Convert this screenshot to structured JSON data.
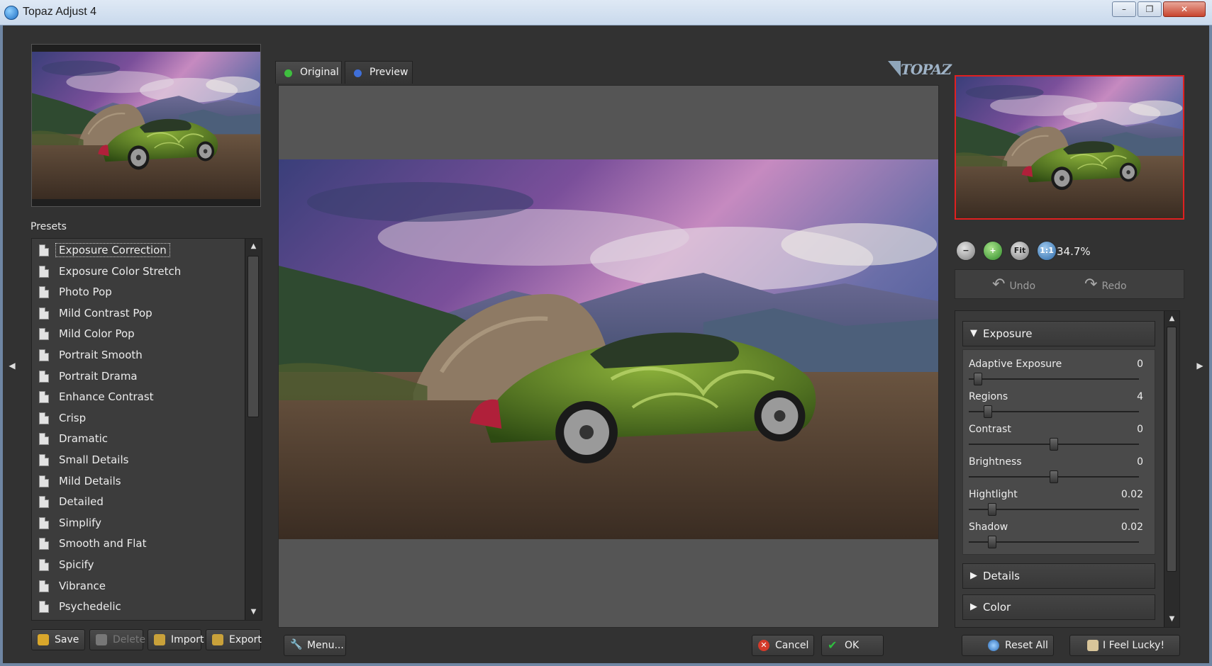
{
  "window": {
    "title": "Topaz Adjust 4",
    "controls": [
      "–",
      "❐",
      "✕"
    ]
  },
  "presets": {
    "label": "Presets",
    "selected_index": 0,
    "items": [
      "Exposure Correction",
      "Exposure Color Stretch",
      "Photo Pop",
      "Mild Contrast Pop",
      "Mild Color Pop",
      "Portrait Smooth",
      "Portrait Drama",
      "Enhance Contrast",
      "Crisp",
      "Dramatic",
      "Small Details",
      "Mild Details",
      "Detailed",
      "Simplify",
      "Smooth and Flat",
      "Spicify",
      "Vibrance",
      "Psychedelic"
    ],
    "buttons": {
      "save": "Save",
      "delete": "Delete",
      "import": "Import",
      "export": "Export"
    }
  },
  "view_tabs": {
    "original": "Original",
    "preview": "Preview",
    "active": "Preview"
  },
  "logo_text": "TOPAZ",
  "bottom_buttons": {
    "menu": "Menu...",
    "cancel": "Cancel",
    "ok": "OK",
    "reset_all": "Reset All",
    "feel_lucky": "I Feel Lucky!"
  },
  "zoom": {
    "fit_label": "Fit",
    "one_to_one_label": "1:1",
    "percent": "34.7%"
  },
  "history": {
    "undo": "Undo",
    "redo": "Redo"
  },
  "sections": {
    "exposure": {
      "title": "Exposure",
      "expanded": true,
      "sliders": [
        {
          "name": "Adaptive Exposure",
          "value": "0",
          "level": 0.03
        },
        {
          "name": "Regions",
          "value": "4",
          "level": 0.09
        },
        {
          "name": "Contrast",
          "value": "0",
          "level": 0.5
        },
        {
          "name": "Brightness",
          "value": "0",
          "level": 0.5
        },
        {
          "name": "Hightlight",
          "value": "0.02",
          "level": 0.12
        },
        {
          "name": "Shadow",
          "value": "0.02",
          "level": 0.12
        }
      ]
    },
    "details": {
      "title": "Details",
      "expanded": false
    },
    "color": {
      "title": "Color",
      "expanded": false
    }
  },
  "colors": {
    "original_dot": "#3fbf3f",
    "preview_dot": "#3f6fd8",
    "cancel_icon": "#d43a2a",
    "ok_icon": "#2fbf3f",
    "navigator_border": "#e02020"
  }
}
